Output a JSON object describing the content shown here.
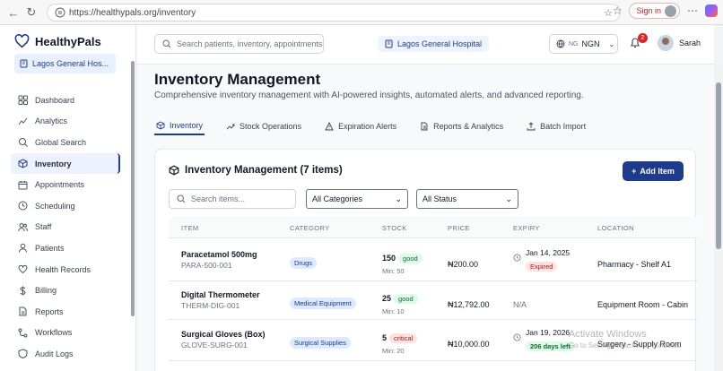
{
  "browser": {
    "url": "https://healthypals.org/inventory",
    "signin_label": "Sign in"
  },
  "brand": {
    "name": "HealthyPals",
    "hospital": "Lagos General Hos..."
  },
  "sidebar": {
    "items": [
      {
        "label": "Dashboard",
        "icon": "dashboard-icon"
      },
      {
        "label": "Analytics",
        "icon": "analytics-icon"
      },
      {
        "label": "Global Search",
        "icon": "search-icon"
      },
      {
        "label": "Inventory",
        "icon": "box-icon",
        "active": true
      },
      {
        "label": "Appointments",
        "icon": "calendar-icon"
      },
      {
        "label": "Scheduling",
        "icon": "clock-icon"
      },
      {
        "label": "Staff",
        "icon": "users-icon"
      },
      {
        "label": "Patients",
        "icon": "user-icon"
      },
      {
        "label": "Health Records",
        "icon": "heart-icon"
      },
      {
        "label": "Billing",
        "icon": "dollar-icon"
      },
      {
        "label": "Reports",
        "icon": "file-icon"
      },
      {
        "label": "Workflows",
        "icon": "workflow-icon"
      },
      {
        "label": "Audit Logs",
        "icon": "shield-icon"
      }
    ]
  },
  "header": {
    "search_placeholder": "Search patients, inventory, appointments",
    "hospital": "Lagos General Hospital",
    "currency_flag": "NG",
    "currency": "NGN",
    "notifications": "2",
    "user": "Sarah"
  },
  "page": {
    "title": "Inventory Management",
    "subtitle": "Comprehensive inventory management with AI-powered insights, automated alerts, and advanced reporting.",
    "tabs": [
      "Inventory",
      "Stock Operations",
      "Expiration Alerts",
      "Reports & Analytics",
      "Batch Import"
    ]
  },
  "card": {
    "title": "Inventory Management (7 items)",
    "add_label": "Add Item",
    "search_placeholder": "Search items...",
    "category_filter": "All Categories",
    "status_filter": "All Status",
    "columns": [
      "ITEM",
      "CATEGORY",
      "STOCK",
      "PRICE",
      "EXPIRY",
      "LOCATION"
    ],
    "rows": [
      {
        "name": "Paracetamol 500mg",
        "sku": "PARA-500-001",
        "category": "Drugs",
        "stock": "150",
        "stock_status": "good",
        "min": "Min: 50",
        "price": "₦200.00",
        "expiry": "Jan 14, 2025",
        "expiry_badge": "Expired",
        "location": "Pharmacy - Shelf A1"
      },
      {
        "name": "Digital Thermometer",
        "sku": "THERM-DIG-001",
        "category": "Medical Equipment",
        "stock": "25",
        "stock_status": "good",
        "min": "Min: 10",
        "price": "₦12,792.00",
        "expiry": "N/A",
        "expiry_badge": "",
        "location": "Equipment Room - Cabin"
      },
      {
        "name": "Surgical Gloves (Box)",
        "sku": "GLOVE-SURG-001",
        "category": "Surgical Supplies",
        "stock": "5",
        "stock_status": "critical",
        "min": "Min: 20",
        "price": "₦10,000.00",
        "expiry": "Jan 19, 2026",
        "expiry_badge": "206 days left",
        "location": "Surgery - Supply Room"
      }
    ]
  },
  "watermark": {
    "line1": "Activate Windows",
    "line2": "Go to Settings to activate Windows."
  }
}
